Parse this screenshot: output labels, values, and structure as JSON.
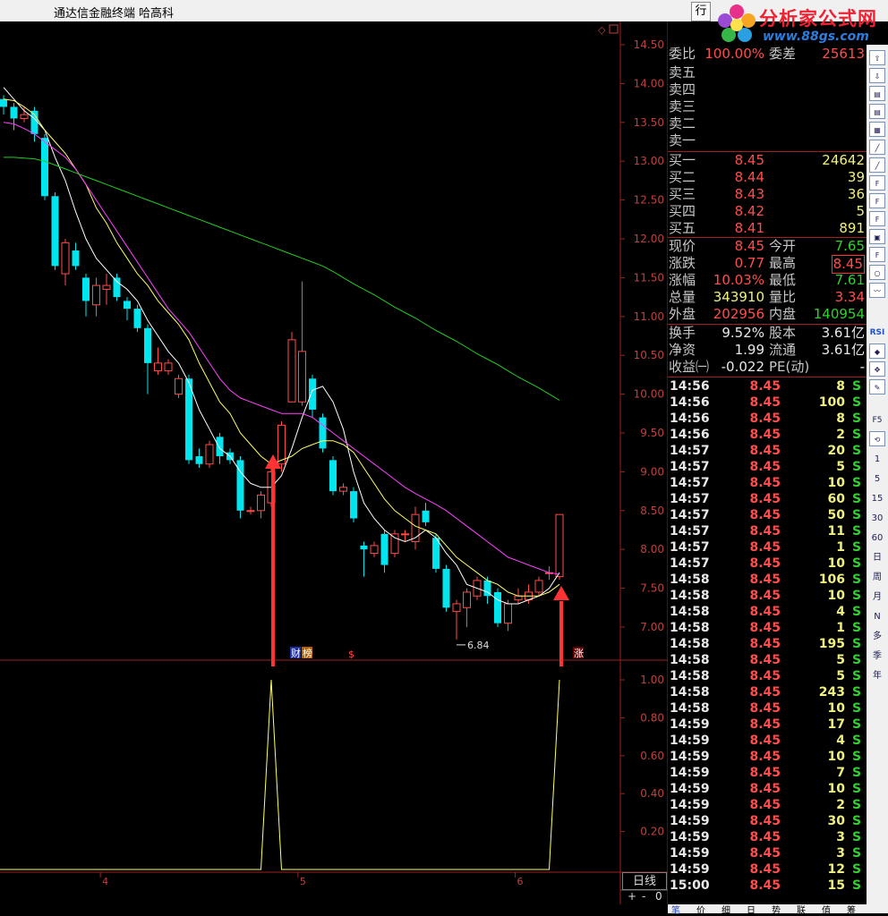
{
  "title": {
    "app": "通达信金融终端",
    "stock": "哈高科",
    "hq_btn": "行"
  },
  "logo": {
    "name": "分析家公式网",
    "url": "www.88gs.com"
  },
  "colors": {
    "up": "#ff4d4d",
    "down": "#00e5ee",
    "ma5": "#ffffff",
    "ma10": "#ffff66",
    "ma20": "#ff40ff",
    "ma60": "#22cc22",
    "signal": "#ffff66",
    "arrow": "#ff3333"
  },
  "price_axis": [
    "14.50",
    "14.00",
    "13.50",
    "13.00",
    "12.50",
    "12.00",
    "11.50",
    "11.00",
    "10.50",
    "10.00",
    "9.50",
    "9.00",
    "8.50",
    "8.00",
    "7.50",
    "7.00"
  ],
  "ind_axis": [
    "1.00",
    "0.80",
    "0.60",
    "0.40",
    "0.20"
  ],
  "x_labels": [
    "4",
    "5",
    "6"
  ],
  "annotations": {
    "low": "6.84",
    "flag1": "财",
    "flag2": "榜",
    "flag3": "$",
    "flag4": "涨"
  },
  "day_tab": "日线",
  "ctrl": {
    "plus": "+",
    "minus": "-",
    "zero": "0"
  },
  "quote": {
    "wb_label": "委比",
    "wb_value": "100.00%",
    "wc_label": "委差",
    "wc_value": "25613",
    "sell": [
      {
        "l": "卖五"
      },
      {
        "l": "卖四"
      },
      {
        "l": "卖三"
      },
      {
        "l": "卖二"
      },
      {
        "l": "卖一"
      }
    ],
    "buy": [
      {
        "l": "买一",
        "p": "8.45",
        "v": "24642"
      },
      {
        "l": "买二",
        "p": "8.44",
        "v": "39"
      },
      {
        "l": "买三",
        "p": "8.43",
        "v": "36"
      },
      {
        "l": "买四",
        "p": "8.42",
        "v": "5"
      },
      {
        "l": "买五",
        "p": "8.41",
        "v": "891"
      }
    ],
    "rows1": [
      {
        "l1": "现价",
        "v1": "8.45",
        "l2": "今开",
        "v2": "7.65"
      },
      {
        "l1": "涨跌",
        "v1": "0.77",
        "l2": "最高",
        "v2": "8.45"
      },
      {
        "l1": "涨幅",
        "v1": "10.03%",
        "l2": "最低",
        "v2": "7.61"
      },
      {
        "l1": "总量",
        "v1": "343910",
        "l2": "量比",
        "v2": "3.34"
      },
      {
        "l1": "外盘",
        "v1": "202956",
        "l2": "内盘",
        "v2": "140954"
      }
    ],
    "rows2": [
      {
        "l1": "换手",
        "v1": "9.52%",
        "l2": "股本",
        "v2": "3.61亿"
      },
      {
        "l1": "净资",
        "v1": "1.99",
        "l2": "流通",
        "v2": "3.61亿"
      },
      {
        "l1": "收益㈠",
        "v1": "-0.022",
        "l2": "PE(动)",
        "v2": "-"
      }
    ]
  },
  "ticks": [
    {
      "t": "14:56",
      "p": "8.45",
      "v": "8",
      "s": "S"
    },
    {
      "t": "14:56",
      "p": "8.45",
      "v": "100",
      "s": "S"
    },
    {
      "t": "14:56",
      "p": "8.45",
      "v": "8",
      "s": "S"
    },
    {
      "t": "14:56",
      "p": "8.45",
      "v": "2",
      "s": "S"
    },
    {
      "t": "14:57",
      "p": "8.45",
      "v": "20",
      "s": "S"
    },
    {
      "t": "14:57",
      "p": "8.45",
      "v": "5",
      "s": "S"
    },
    {
      "t": "14:57",
      "p": "8.45",
      "v": "10",
      "s": "S"
    },
    {
      "t": "14:57",
      "p": "8.45",
      "v": "60",
      "s": "S"
    },
    {
      "t": "14:57",
      "p": "8.45",
      "v": "50",
      "s": "S"
    },
    {
      "t": "14:57",
      "p": "8.45",
      "v": "11",
      "s": "S"
    },
    {
      "t": "14:57",
      "p": "8.45",
      "v": "1",
      "s": "S"
    },
    {
      "t": "14:57",
      "p": "8.45",
      "v": "10",
      "s": "S"
    },
    {
      "t": "14:58",
      "p": "8.45",
      "v": "106",
      "s": "S"
    },
    {
      "t": "14:58",
      "p": "8.45",
      "v": "10",
      "s": "S"
    },
    {
      "t": "14:58",
      "p": "8.45",
      "v": "4",
      "s": "S"
    },
    {
      "t": "14:58",
      "p": "8.45",
      "v": "1",
      "s": "S"
    },
    {
      "t": "14:58",
      "p": "8.45",
      "v": "195",
      "s": "S"
    },
    {
      "t": "14:58",
      "p": "8.45",
      "v": "5",
      "s": "S"
    },
    {
      "t": "14:58",
      "p": "8.45",
      "v": "5",
      "s": "S"
    },
    {
      "t": "14:58",
      "p": "8.45",
      "v": "243",
      "s": "S"
    },
    {
      "t": "14:58",
      "p": "8.45",
      "v": "10",
      "s": "S"
    },
    {
      "t": "14:59",
      "p": "8.45",
      "v": "17",
      "s": "S"
    },
    {
      "t": "14:59",
      "p": "8.45",
      "v": "4",
      "s": "S"
    },
    {
      "t": "14:59",
      "p": "8.45",
      "v": "10",
      "s": "S"
    },
    {
      "t": "14:59",
      "p": "8.45",
      "v": "7",
      "s": "S"
    },
    {
      "t": "14:59",
      "p": "8.45",
      "v": "10",
      "s": "S"
    },
    {
      "t": "14:59",
      "p": "8.45",
      "v": "2",
      "s": "S"
    },
    {
      "t": "14:59",
      "p": "8.45",
      "v": "30",
      "s": "S"
    },
    {
      "t": "14:59",
      "p": "8.45",
      "v": "3",
      "s": "S"
    },
    {
      "t": "14:59",
      "p": "8.45",
      "v": "3",
      "s": "S"
    },
    {
      "t": "14:59",
      "p": "8.45",
      "v": "12",
      "s": "S"
    },
    {
      "t": "15:00",
      "p": "8.45",
      "v": "15",
      "s": "S"
    }
  ],
  "toolbar": [
    "RSI",
    "F5",
    "1",
    "5",
    "15",
    "30",
    "60",
    "日",
    "周",
    "月",
    "N",
    "多",
    "季",
    "年"
  ],
  "bottom_tabs": [
    "笔",
    "价",
    "细",
    "日",
    "势",
    "联",
    "值",
    "筹"
  ],
  "chart_data": {
    "type": "candlestick",
    "price_range": [
      6.8,
      14.5
    ],
    "candles": [
      {
        "o": 13.8,
        "c": 13.7,
        "h": 13.85,
        "l": 13.6
      },
      {
        "o": 13.7,
        "c": 13.55,
        "h": 13.75,
        "l": 13.4
      },
      {
        "o": 13.55,
        "c": 13.6,
        "h": 13.7,
        "l": 13.5
      },
      {
        "o": 13.65,
        "c": 13.35,
        "h": 13.7,
        "l": 13.25
      },
      {
        "o": 13.3,
        "c": 12.55,
        "h": 13.35,
        "l": 12.5
      },
      {
        "o": 12.55,
        "c": 11.65,
        "h": 12.6,
        "l": 11.6
      },
      {
        "o": 11.55,
        "c": 11.95,
        "h": 12.0,
        "l": 11.4
      },
      {
        "o": 11.85,
        "c": 11.65,
        "h": 11.95,
        "l": 11.6
      },
      {
        "o": 11.5,
        "c": 11.2,
        "h": 11.55,
        "l": 11.0
      },
      {
        "o": 11.15,
        "c": 11.4,
        "h": 11.5,
        "l": 11.0
      },
      {
        "o": 11.35,
        "c": 11.4,
        "h": 11.55,
        "l": 11.15
      },
      {
        "o": 11.5,
        "c": 11.25,
        "h": 11.55,
        "l": 11.2
      },
      {
        "o": 11.2,
        "c": 11.1,
        "h": 11.25,
        "l": 10.95
      },
      {
        "o": 11.1,
        "c": 10.85,
        "h": 11.15,
        "l": 10.8
      },
      {
        "o": 10.85,
        "c": 10.4,
        "h": 10.9,
        "l": 10.0
      },
      {
        "o": 10.3,
        "c": 10.4,
        "h": 10.6,
        "l": 10.25
      },
      {
        "o": 10.3,
        "c": 10.4,
        "h": 10.45,
        "l": 10.25
      },
      {
        "o": 10.0,
        "c": 10.2,
        "h": 10.25,
        "l": 9.95
      },
      {
        "o": 10.2,
        "c": 9.15,
        "h": 10.25,
        "l": 9.1
      },
      {
        "o": 9.2,
        "c": 9.1,
        "h": 9.3,
        "l": 9.05
      },
      {
        "o": 9.1,
        "c": 9.35,
        "h": 9.4,
        "l": 9.05
      },
      {
        "o": 9.45,
        "c": 9.2,
        "h": 9.5,
        "l": 9.1
      },
      {
        "o": 9.25,
        "c": 9.15,
        "h": 9.3,
        "l": 9.1
      },
      {
        "o": 9.15,
        "c": 8.5,
        "h": 9.2,
        "l": 8.4
      },
      {
        "o": 8.5,
        "c": 8.5,
        "h": 8.55,
        "l": 8.45
      },
      {
        "o": 8.5,
        "c": 8.7,
        "h": 8.75,
        "l": 8.4
      },
      {
        "o": 8.6,
        "c": 9.0,
        "h": 9.05,
        "l": 8.55
      },
      {
        "o": 9.1,
        "c": 9.6,
        "h": 9.65,
        "l": 9.0
      },
      {
        "o": 9.9,
        "c": 10.7,
        "h": 10.8,
        "l": 9.9
      },
      {
        "o": 9.9,
        "c": 10.55,
        "h": 11.45,
        "l": 9.85
      },
      {
        "o": 10.2,
        "c": 9.8,
        "h": 10.25,
        "l": 9.7
      },
      {
        "o": 9.7,
        "c": 9.3,
        "h": 9.75,
        "l": 9.25
      },
      {
        "o": 9.15,
        "c": 8.75,
        "h": 9.2,
        "l": 8.7
      },
      {
        "o": 8.75,
        "c": 8.8,
        "h": 8.85,
        "l": 8.7
      },
      {
        "o": 8.75,
        "c": 8.4,
        "h": 8.8,
        "l": 8.35
      },
      {
        "o": 8.05,
        "c": 8.0,
        "h": 8.1,
        "l": 7.65
      },
      {
        "o": 7.95,
        "c": 8.05,
        "h": 8.1,
        "l": 7.9
      },
      {
        "o": 8.2,
        "c": 7.8,
        "h": 8.25,
        "l": 7.7
      },
      {
        "o": 7.95,
        "c": 8.2,
        "h": 8.25,
        "l": 7.9
      },
      {
        "o": 8.2,
        "c": 8.2,
        "h": 8.25,
        "l": 8.1
      },
      {
        "o": 8.1,
        "c": 8.45,
        "h": 8.55,
        "l": 8.0
      },
      {
        "o": 8.5,
        "c": 8.35,
        "h": 8.6,
        "l": 8.3
      },
      {
        "o": 8.15,
        "c": 7.75,
        "h": 8.2,
        "l": 7.7
      },
      {
        "o": 7.75,
        "c": 7.25,
        "h": 7.8,
        "l": 7.2
      },
      {
        "o": 7.2,
        "c": 7.3,
        "h": 7.35,
        "l": 6.84
      },
      {
        "o": 7.25,
        "c": 7.45,
        "h": 7.5,
        "l": 7.0
      },
      {
        "o": 7.4,
        "c": 7.6,
        "h": 7.65,
        "l": 7.35
      },
      {
        "o": 7.6,
        "c": 7.4,
        "h": 7.65,
        "l": 7.3
      },
      {
        "o": 7.45,
        "c": 7.05,
        "h": 7.5,
        "l": 7.0
      },
      {
        "o": 7.05,
        "c": 7.3,
        "h": 7.35,
        "l": 6.95
      },
      {
        "o": 7.35,
        "c": 7.4,
        "h": 7.5,
        "l": 7.3
      },
      {
        "o": 7.35,
        "c": 7.45,
        "h": 7.55,
        "l": 7.3
      },
      {
        "o": 7.45,
        "c": 7.6,
        "h": 7.65,
        "l": 7.4
      },
      {
        "o": 7.7,
        "c": 7.7,
        "h": 7.78,
        "l": 7.61
      },
      {
        "o": 7.65,
        "c": 8.45,
        "h": 8.45,
        "l": 7.61
      }
    ],
    "ma_series": [
      {
        "key": "ma5",
        "values": [
          13.95,
          13.8,
          13.65,
          13.55,
          13.4,
          13.05,
          12.75,
          12.35,
          12.0,
          11.75,
          11.6,
          11.45,
          11.35,
          11.2,
          10.95,
          10.75,
          10.55,
          10.4,
          10.15,
          9.8,
          9.55,
          9.3,
          9.2,
          9.0,
          8.85,
          8.8,
          8.8,
          8.95,
          9.3,
          9.7,
          10.05,
          10.1,
          9.9,
          9.55,
          9.0,
          8.6,
          8.4,
          8.25,
          8.15,
          8.1,
          8.15,
          8.25,
          8.15,
          7.95,
          7.8,
          7.55,
          7.5,
          7.45,
          7.35,
          7.3,
          7.3,
          7.35,
          7.4,
          7.5,
          7.7
        ]
      },
      {
        "key": "ma10",
        "values": [
          13.8,
          13.78,
          13.7,
          13.6,
          13.4,
          13.25,
          13.1,
          12.9,
          12.7,
          12.4,
          12.2,
          11.95,
          11.75,
          11.55,
          11.4,
          11.2,
          11.05,
          10.9,
          10.7,
          10.4,
          10.15,
          9.9,
          9.75,
          9.5,
          9.35,
          9.2,
          9.1,
          9.15,
          9.2,
          9.3,
          9.35,
          9.4,
          9.4,
          9.35,
          9.25,
          9.05,
          8.85,
          8.65,
          8.5,
          8.4,
          8.3,
          8.25,
          8.2,
          8.05,
          7.9,
          7.8,
          7.7,
          7.6,
          7.55,
          7.45,
          7.4,
          7.4,
          7.4,
          7.45,
          7.55
        ]
      },
      {
        "key": "ma20",
        "values": [
          13.5,
          13.48,
          13.42,
          13.35,
          13.25,
          13.15,
          13.05,
          12.9,
          12.7,
          12.5,
          12.3,
          12.1,
          11.9,
          11.7,
          11.5,
          11.3,
          11.1,
          10.95,
          10.8,
          10.6,
          10.4,
          10.2,
          10.05,
          9.95,
          9.9,
          9.85,
          9.8,
          9.75,
          9.75,
          9.75,
          9.7,
          9.6,
          9.5,
          9.4,
          9.3,
          9.2,
          9.1,
          9.0,
          8.9,
          8.8,
          8.72,
          8.65,
          8.58,
          8.5,
          8.4,
          8.3,
          8.2,
          8.1,
          8.0,
          7.9,
          7.85,
          7.8,
          7.75,
          7.7,
          7.68
        ]
      },
      {
        "key": "ma60",
        "values": [
          13.05,
          13.05,
          13.04,
          13.03,
          13.0,
          12.95,
          12.9,
          12.85,
          12.8,
          12.75,
          12.7,
          12.65,
          12.6,
          12.55,
          12.5,
          12.45,
          12.4,
          12.35,
          12.3,
          12.25,
          12.2,
          12.15,
          12.1,
          12.05,
          12.0,
          11.95,
          11.9,
          11.85,
          11.8,
          11.75,
          11.7,
          11.65,
          11.58,
          11.5,
          11.42,
          11.35,
          11.28,
          11.2,
          11.12,
          11.05,
          10.98,
          10.9,
          10.82,
          10.75,
          10.68,
          10.6,
          10.52,
          10.45,
          10.38,
          10.3,
          10.22,
          10.15,
          10.08,
          10.0,
          9.92
        ]
      }
    ],
    "signal": {
      "range": [
        0,
        1
      ],
      "ones_at": [
        26,
        54
      ]
    }
  }
}
